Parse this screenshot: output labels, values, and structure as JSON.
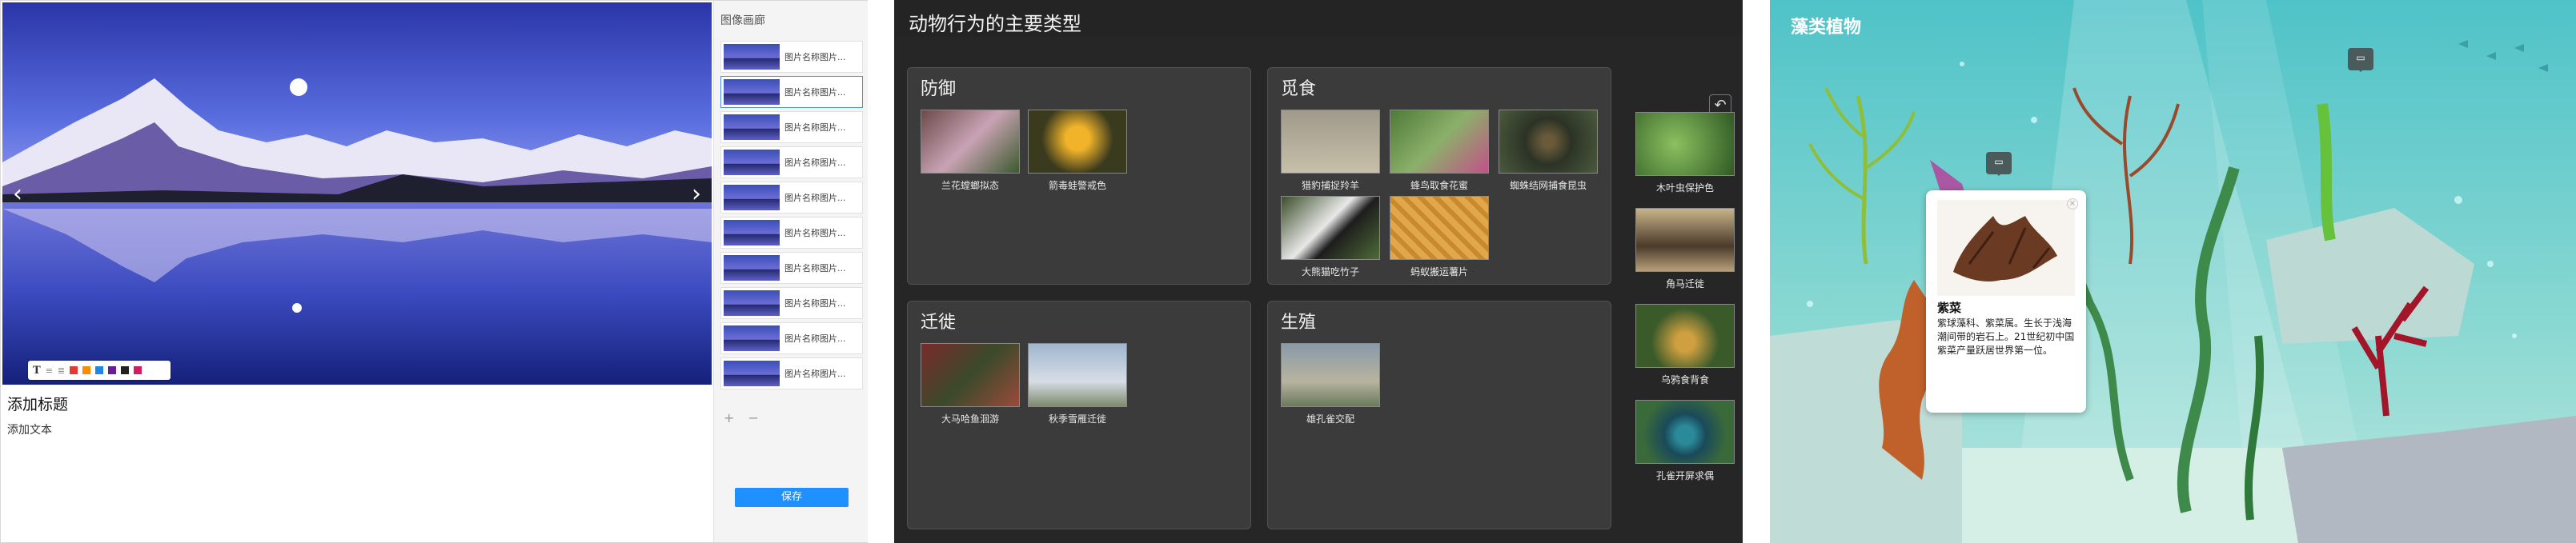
{
  "panel1": {
    "sidebar_title": "图像画廊",
    "thumb_label": "图片名称图片...",
    "thumbs": [
      "图片名称图片...",
      "图片名称图片...",
      "图片名称图片...",
      "图片名称图片...",
      "图片名称图片...",
      "图片名称图片...",
      "图片名称图片...",
      "图片名称图片...",
      "图片名称图片...",
      "图片名称图片..."
    ],
    "caption_title": "添加标题",
    "caption_text": "添加文本",
    "prev_icon": "‹",
    "next_icon": "›",
    "add_remove": "+ −",
    "save_label": "保存",
    "annotation_tool": "T",
    "annotation_colors": [
      "#e53935",
      "#fb8c00",
      "#1e88e5",
      "#6a1b9a",
      "#212121",
      "#d81b60"
    ]
  },
  "panel2": {
    "title": "动物行为的主要类型",
    "undo_icon": "↶",
    "categories": [
      {
        "name": "防御",
        "cards": [
          "兰花螳螂拟态",
          "箭毒蛙警戒色"
        ]
      },
      {
        "name": "觅食",
        "cards": [
          "猎豹捕捉羚羊",
          "蜂鸟取食花蜜",
          "蜘蛛结网捕食昆虫",
          "大熊猫吃竹子",
          "蚂蚁搬运薯片"
        ]
      },
      {
        "name": "迁徙",
        "cards": [
          "大马哈鱼洄游",
          "秋季雪雁迁徙"
        ]
      },
      {
        "name": "生殖",
        "cards": [
          "雄孔雀交配"
        ]
      }
    ],
    "unsorted": [
      "木叶虫保护色",
      "角马迁徙",
      "乌鸦食背食",
      "孔雀开屏求偶"
    ]
  },
  "panel3": {
    "title": "藻类植物",
    "popup_title": "紫菜",
    "popup_text": "紫球藻科、紫菜属。生长于浅海潮间带的岩石上。21世纪初中国紫菜产量跃居世界第一位。",
    "close_icon": "×",
    "bubble_icon": "▭"
  }
}
